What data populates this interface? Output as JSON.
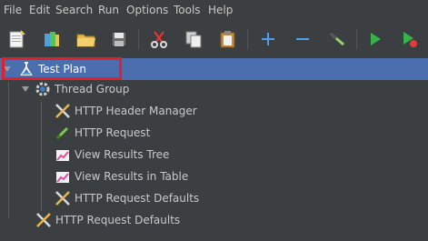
{
  "menu": {
    "file": "File",
    "edit": "Edit",
    "search": "Search",
    "run": "Run",
    "options": "Options",
    "tools": "Tools",
    "help": "Help"
  },
  "toolbar": {
    "icons": [
      "new-icon",
      "templates-icon",
      "open-icon",
      "save-icon",
      "cut-icon",
      "copy-icon",
      "paste-icon",
      "expand-icon",
      "collapse-icon",
      "toggle-icon",
      "start-icon",
      "start-no-pauses-icon"
    ]
  },
  "tree": {
    "test_plan": "Test Plan",
    "thread_group": "Thread Group",
    "http_header_manager": "HTTP Header Manager",
    "http_request": "HTTP Request",
    "view_results_tree": "View Results Tree",
    "view_results_in_table": "View Results in Table",
    "http_request_defaults_inner": "HTTP Request Defaults",
    "http_request_defaults_outer": "HTTP Request Defaults"
  },
  "colors": {
    "background": "#3c3f41",
    "selection": "#4b6eaf",
    "highlight_box": "#e0202a"
  }
}
